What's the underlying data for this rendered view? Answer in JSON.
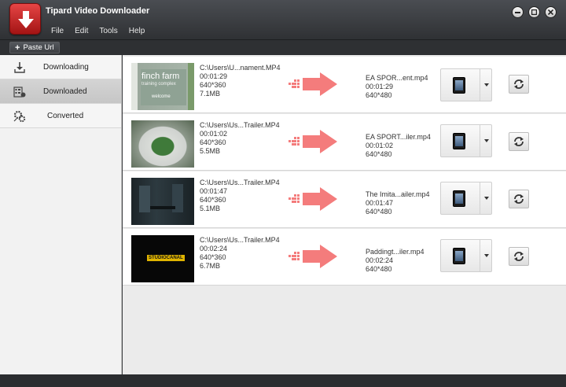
{
  "app": {
    "title": "Tipard Video Downloader"
  },
  "menu": [
    "File",
    "Edit",
    "Tools",
    "Help"
  ],
  "toolbar": {
    "paste_label": "Paste Url"
  },
  "sidebar": {
    "items": [
      {
        "label": "Downloading",
        "icon": "download-icon"
      },
      {
        "label": "Downloaded",
        "icon": "film-list-icon"
      },
      {
        "label": "Converted",
        "icon": "convert-gears-icon"
      }
    ],
    "active": "Downloaded"
  },
  "rows": [
    {
      "thumb_text": {
        "line1": "finch farm",
        "line2": "training complex",
        "line3": "welcome"
      },
      "src": {
        "path": "C:\\Users\\U...nament.MP4",
        "duration": "00:01:29",
        "resolution": "640*360",
        "size": "7.1MB"
      },
      "dst": {
        "name": "EA SPOR...ent.mp4",
        "duration": "00:01:29",
        "resolution": "640*480"
      }
    },
    {
      "src": {
        "path": "C:\\Users\\Us...Trailer.MP4",
        "duration": "00:01:02",
        "resolution": "640*360",
        "size": "5.5MB"
      },
      "dst": {
        "name": "EA SPORT...iler.mp4",
        "duration": "00:01:02",
        "resolution": "640*480"
      }
    },
    {
      "src": {
        "path": "C:\\Users\\Us...Trailer.MP4",
        "duration": "00:01:47",
        "resolution": "640*360",
        "size": "5.1MB"
      },
      "dst": {
        "name": "The Imita...ailer.mp4",
        "duration": "00:01:47",
        "resolution": "640*480"
      }
    },
    {
      "thumb_text": {
        "line1": "STUDIOCANAL"
      },
      "src": {
        "path": "C:\\Users\\Us...Trailer.MP4",
        "duration": "00:02:24",
        "resolution": "640*360",
        "size": "6.7MB"
      },
      "dst": {
        "name": "Paddingt...iler.mp4",
        "duration": "00:02:24",
        "resolution": "640*480"
      }
    }
  ],
  "colors": {
    "accent_red": "#d91e1e",
    "arrow_pink": "#f47c7c",
    "title_bg": "#3a3c3f"
  }
}
